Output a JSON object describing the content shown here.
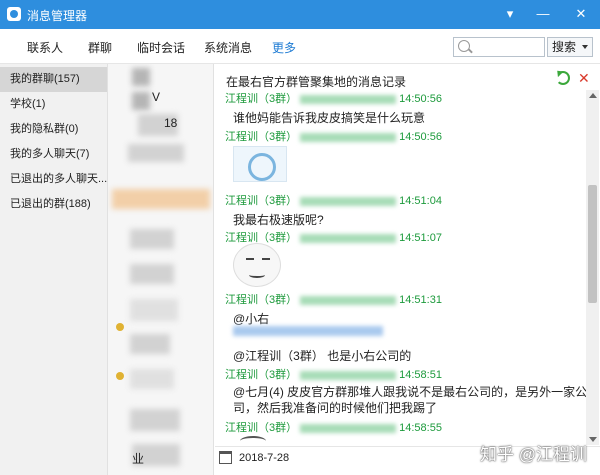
{
  "window": {
    "title": "消息管理器"
  },
  "nav": {
    "tabs": [
      {
        "label": "联系人"
      },
      {
        "label": "群聊"
      },
      {
        "label": "临时会话"
      },
      {
        "label": "系统消息"
      },
      {
        "label": "更多"
      }
    ],
    "search_placeholder": "",
    "search_button": "搜索"
  },
  "sidebar": {
    "items": [
      {
        "label": "我的群聊(157)"
      },
      {
        "label": "学校(1)"
      },
      {
        "label": "我的隐私群(0)"
      },
      {
        "label": "我的多人聊天(7)"
      },
      {
        "label": "已退出的多人聊天..."
      },
      {
        "label": "已退出的群(188)"
      }
    ]
  },
  "list": {
    "partial_texts": [
      "18",
      "V",
      "业"
    ]
  },
  "messages": {
    "header": "在最右官方群管聚集地的消息记录",
    "entries": [
      {
        "sender": "江程训（3群）",
        "time": "14:50:56",
        "text": "谁他妈能告诉我皮皮搞笑是什么玩意"
      },
      {
        "sender": "江程训（3群）",
        "time": "14:50:56",
        "image": "image-thumbnail"
      },
      {
        "sender": "江程训（3群）",
        "time": "14:51:04",
        "text": "我最右极速版呢?"
      },
      {
        "sender": "江程训（3群）",
        "time": "14:51:07",
        "image": "sticker-face"
      },
      {
        "sender": "江程训（3群）",
        "time": "14:51:31",
        "text": "@小右"
      },
      {
        "sender": "",
        "time": "",
        "text": "@江程训（3群） 也是小右公司的"
      },
      {
        "sender": "江程训（3群）",
        "time": "14:58:51",
        "text": "@七月(4) 皮皮官方群那堆人跟我说不是最右公司的，是另外一家公司，然后我准备问的时候他们把我踢了"
      },
      {
        "sender": "江程训（3群）",
        "time": "14:58:55",
        "image": "sticker-partial"
      }
    ]
  },
  "footer": {
    "date": "2018-7-28"
  },
  "watermark": "知乎 @江程训",
  "colors": {
    "titlebar": "#2e8ede",
    "active_tab": "#1e7bd3",
    "sender_green": "#1d9a3c"
  }
}
